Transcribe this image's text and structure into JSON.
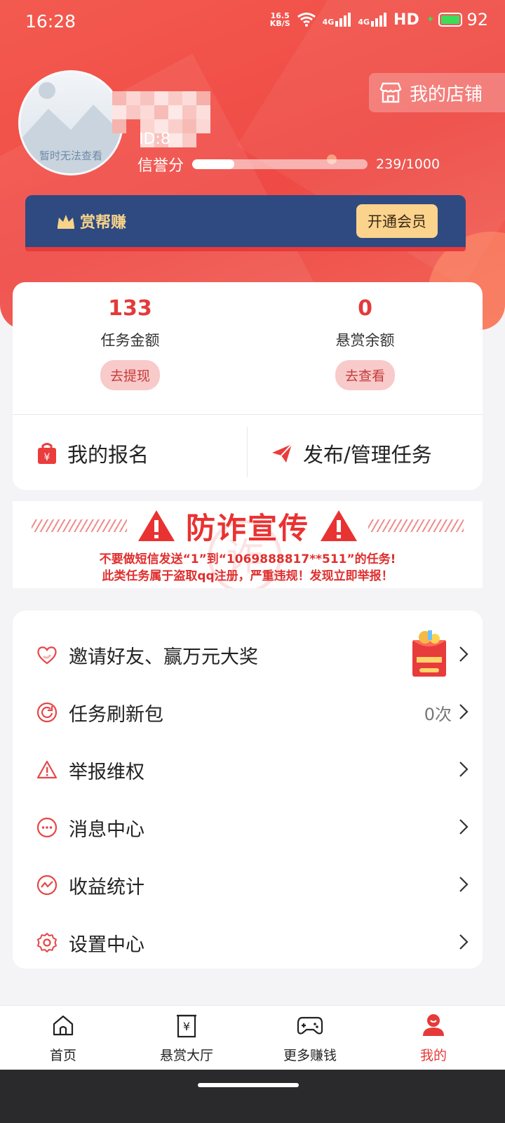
{
  "status": {
    "time": "16:28",
    "speed_top": "16.5",
    "speed_bottom": "KB/S",
    "net1": "4G",
    "net2": "4G",
    "hd": "HD",
    "battery": "92"
  },
  "profile": {
    "avatar_caption": "暂时无法查看",
    "uid_label": "ID:8",
    "credit_label": "信誉分",
    "credit_value": "239/1000",
    "credit_fraction": 0.239,
    "shop_label": "我的店铺"
  },
  "vip": {
    "brand": "赏帮赚",
    "button": "开通会员"
  },
  "balance": {
    "task_amount": {
      "value": "133",
      "label": "任务金额",
      "action": "去提现"
    },
    "reward_balance": {
      "value": "0",
      "label": "悬赏余额",
      "action": "去查看"
    }
  },
  "actions": {
    "my_signup": "我的报名",
    "publish": "发布/管理任务"
  },
  "warning": {
    "title": "防诈宣传",
    "line1": "不要做短信发送“1”到“1069888817**511”的任务!",
    "line2": "此类任务属于盗取qq注册，严重违规！发现立即举报！",
    "stamp": "诈"
  },
  "menu": [
    {
      "label": "邀请好友、赢万元大奖",
      "icon": "heart-icon",
      "right": ""
    },
    {
      "label": "任务刷新包",
      "icon": "refresh-icon",
      "right": "0次"
    },
    {
      "label": "举报维权",
      "icon": "warning-icon",
      "right": ""
    },
    {
      "label": "消息中心",
      "icon": "message-icon",
      "right": ""
    },
    {
      "label": "收益统计",
      "icon": "chart-icon",
      "right": ""
    },
    {
      "label": "设置中心",
      "icon": "settings-icon",
      "right": ""
    }
  ],
  "gift": {
    "line1": "邀请好友",
    "line2": "赢万元大奖"
  },
  "tabs": [
    {
      "label": "首页",
      "icon": "home-icon",
      "active": false
    },
    {
      "label": "悬赏大厅",
      "icon": "reward-hall-icon",
      "active": false
    },
    {
      "label": "更多赚钱",
      "icon": "gamepad-icon",
      "active": false
    },
    {
      "label": "我的",
      "icon": "profile-icon",
      "active": true
    }
  ],
  "colors": {
    "primary": "#ef4a45",
    "vip_bg": "#2f4a80",
    "vip_button": "#fbd38d",
    "active_tab": "#e63a3a"
  }
}
